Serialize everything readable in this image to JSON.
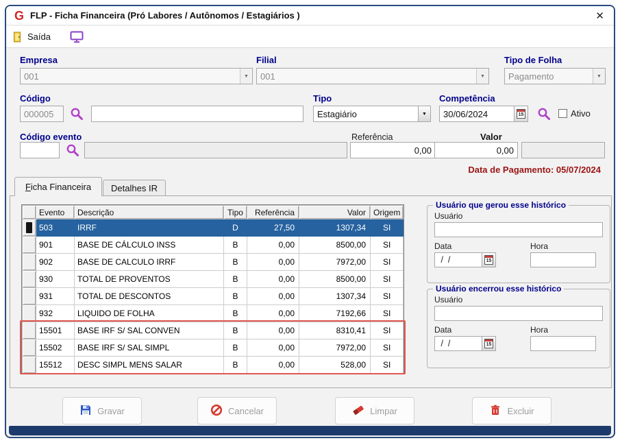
{
  "window": {
    "title": "FLP - Ficha Financeira (Pró Labores / Autônomos / Estagiários )",
    "close": "✕"
  },
  "toolbar": {
    "exit": "Saída"
  },
  "form": {
    "empresa_label": "Empresa",
    "empresa_value": "001",
    "filial_label": "Filial",
    "filial_value": "001",
    "tipo_folha_label": "Tipo de Folha",
    "tipo_folha_value": "Pagamento",
    "codigo_label": "Código",
    "codigo_value": "000005",
    "codigo_nome_value": "",
    "tipo_label": "Tipo",
    "tipo_value": "Estagiário",
    "competencia_label": "Competência",
    "competencia_value": "30/06/2024",
    "ativo_label": "Ativo",
    "codigo_evento_label": "Código evento",
    "codigo_evento_value": "",
    "codigo_evento_desc": "",
    "referencia_label": "Referência",
    "referencia_value": "0,00",
    "valor_label": "Valor",
    "valor_value": "0,00",
    "valor_extra": "",
    "data_pagamento": "Data de Pagamento: 05/07/2024"
  },
  "tabs": [
    {
      "label": "Ficha Financeira"
    },
    {
      "label": "Detalhes IR"
    }
  ],
  "grid": {
    "columns": [
      "Evento",
      "Descrição",
      "Tipo",
      "Referência",
      "Valor",
      "Origem"
    ],
    "rows": [
      {
        "evento": "503",
        "descricao": "IRRF",
        "tipo": "D",
        "referencia": "27,50",
        "valor": "1307,34",
        "origem": "SI",
        "selected": true
      },
      {
        "evento": "901",
        "descricao": "BASE DE CÁLCULO INSS",
        "tipo": "B",
        "referencia": "0,00",
        "valor": "8500,00",
        "origem": "SI"
      },
      {
        "evento": "902",
        "descricao": "BASE DE CALCULO IRRF",
        "tipo": "B",
        "referencia": "0,00",
        "valor": "7972,00",
        "origem": "SI"
      },
      {
        "evento": "930",
        "descricao": "TOTAL DE PROVENTOS",
        "tipo": "B",
        "referencia": "0,00",
        "valor": "8500,00",
        "origem": "SI"
      },
      {
        "evento": "931",
        "descricao": "TOTAL DE DESCONTOS",
        "tipo": "B",
        "referencia": "0,00",
        "valor": "1307,34",
        "origem": "SI"
      },
      {
        "evento": "932",
        "descricao": "LIQUIDO DE FOLHA",
        "tipo": "B",
        "referencia": "0,00",
        "valor": "7192,66",
        "origem": "SI"
      },
      {
        "evento": "15501",
        "descricao": "BASE IRF S/ SAL CONVEN",
        "tipo": "B",
        "referencia": "0,00",
        "valor": "8310,41",
        "origem": "SI",
        "annotated": true
      },
      {
        "evento": "15502",
        "descricao": "BASE IRF S/ SAL SIMPL",
        "tipo": "B",
        "referencia": "0,00",
        "valor": "7972,00",
        "origem": "SI",
        "annotated": true
      },
      {
        "evento": "15512",
        "descricao": "DESC SIMPL MENS SALAR",
        "tipo": "B",
        "referencia": "0,00",
        "valor": "528,00",
        "origem": "SI",
        "annotated": true
      }
    ]
  },
  "history_generated": {
    "title": "Usuário que gerou esse histórico",
    "usuario_label": "Usuário",
    "usuario_value": "",
    "data_label": "Data",
    "data_value": " /  /",
    "hora_label": "Hora",
    "hora_value": ""
  },
  "history_closed": {
    "title": "Usuário encerrou esse histórico",
    "usuario_label": "Usuário",
    "usuario_value": "",
    "data_label": "Data",
    "data_value": " /  /",
    "hora_label": "Hora",
    "hora_value": ""
  },
  "buttons": {
    "gravar": "Gravar",
    "cancelar": "Cancelar",
    "limpar": "Limpar",
    "excluir": "Excluir"
  },
  "icons": {
    "calendar": "15"
  },
  "colors": {
    "navy_label": "#00008B",
    "payment_red": "#9b1313",
    "selected_row": "#26629f",
    "annotation": "#e0574e",
    "bottom_bar": "#1c3a6b",
    "window_border": "#2a4a80"
  }
}
